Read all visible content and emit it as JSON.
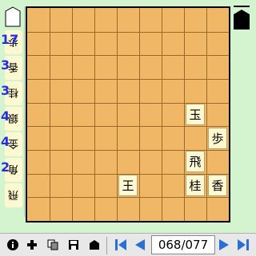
{
  "board": {
    "files": 9,
    "ranks": 9,
    "pieces": [
      {
        "char": "玉",
        "file": 2,
        "rank": 5,
        "side": "black"
      },
      {
        "char": "歩",
        "file": 1,
        "rank": 6,
        "side": "black"
      },
      {
        "char": "飛",
        "file": 2,
        "rank": 7,
        "side": "black"
      },
      {
        "char": "王",
        "file": 5,
        "rank": 8,
        "side": "black"
      },
      {
        "char": "桂",
        "file": 2,
        "rank": 8,
        "side": "black"
      },
      {
        "char": "香",
        "file": 1,
        "rank": 8,
        "side": "black"
      }
    ]
  },
  "hand_white": [
    {
      "char": "歩",
      "count": "17"
    },
    {
      "char": "香",
      "count": "3"
    },
    {
      "char": "桂",
      "count": "3"
    },
    {
      "char": "銀",
      "count": "4"
    },
    {
      "char": "金",
      "count": "4"
    },
    {
      "char": "角",
      "count": "2"
    },
    {
      "char": "飛",
      "count": ""
    }
  ],
  "turn_indicator": {
    "white": "empty",
    "black": "filled"
  },
  "toolbar": {
    "move_counter": "068/077",
    "buttons": [
      "info-icon",
      "add-icon",
      "copy-icon",
      "save-icon",
      "piece-icon",
      "first-icon",
      "prev-icon",
      "next-icon",
      "last-icon"
    ]
  },
  "colors": {
    "board": "#f0b866",
    "background": "#d4f4d0",
    "nav_blue": "#2a6fd6",
    "count_blue": "#2030e0"
  }
}
